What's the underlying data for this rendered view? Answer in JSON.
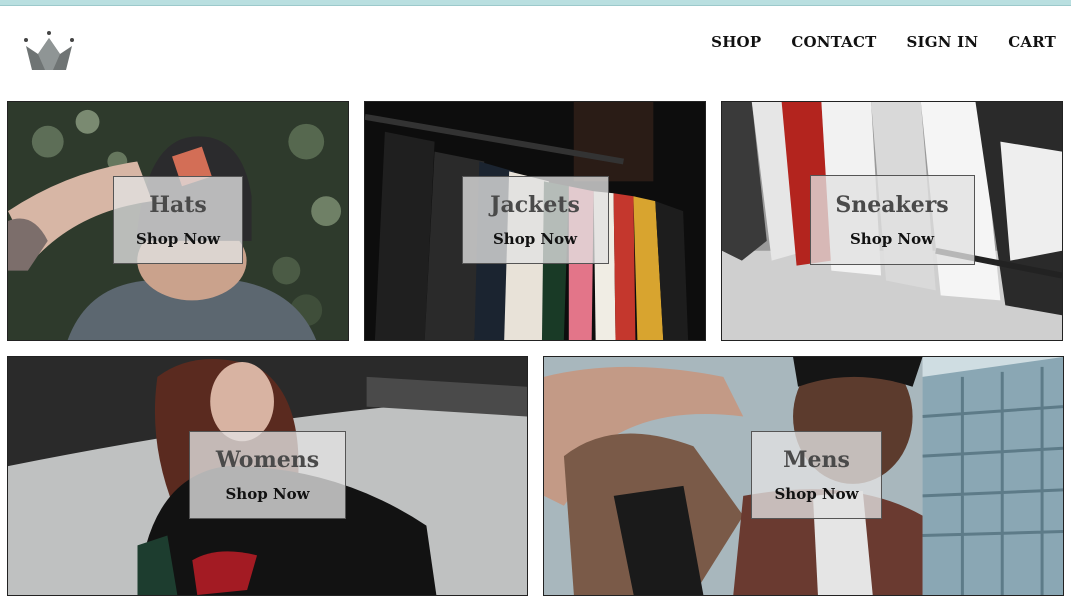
{
  "brand": {
    "logo_icon": "crown-icon"
  },
  "nav": {
    "shop": "SHOP",
    "contact": "CONTACT",
    "sign_in": "SIGN IN",
    "cart": "CART"
  },
  "categories": [
    {
      "title": "Hats",
      "cta": "Shop Now"
    },
    {
      "title": "Jackets",
      "cta": "Shop Now"
    },
    {
      "title": "Sneakers",
      "cta": "Shop Now"
    },
    {
      "title": "Womens",
      "cta": "Shop Now"
    },
    {
      "title": "Mens",
      "cta": "Shop Now"
    }
  ],
  "colors": {
    "top_bar": "#b9dfe0",
    "overlay": "#e1e1e1",
    "title_text": "#4a4a4a",
    "text": "#111111"
  }
}
